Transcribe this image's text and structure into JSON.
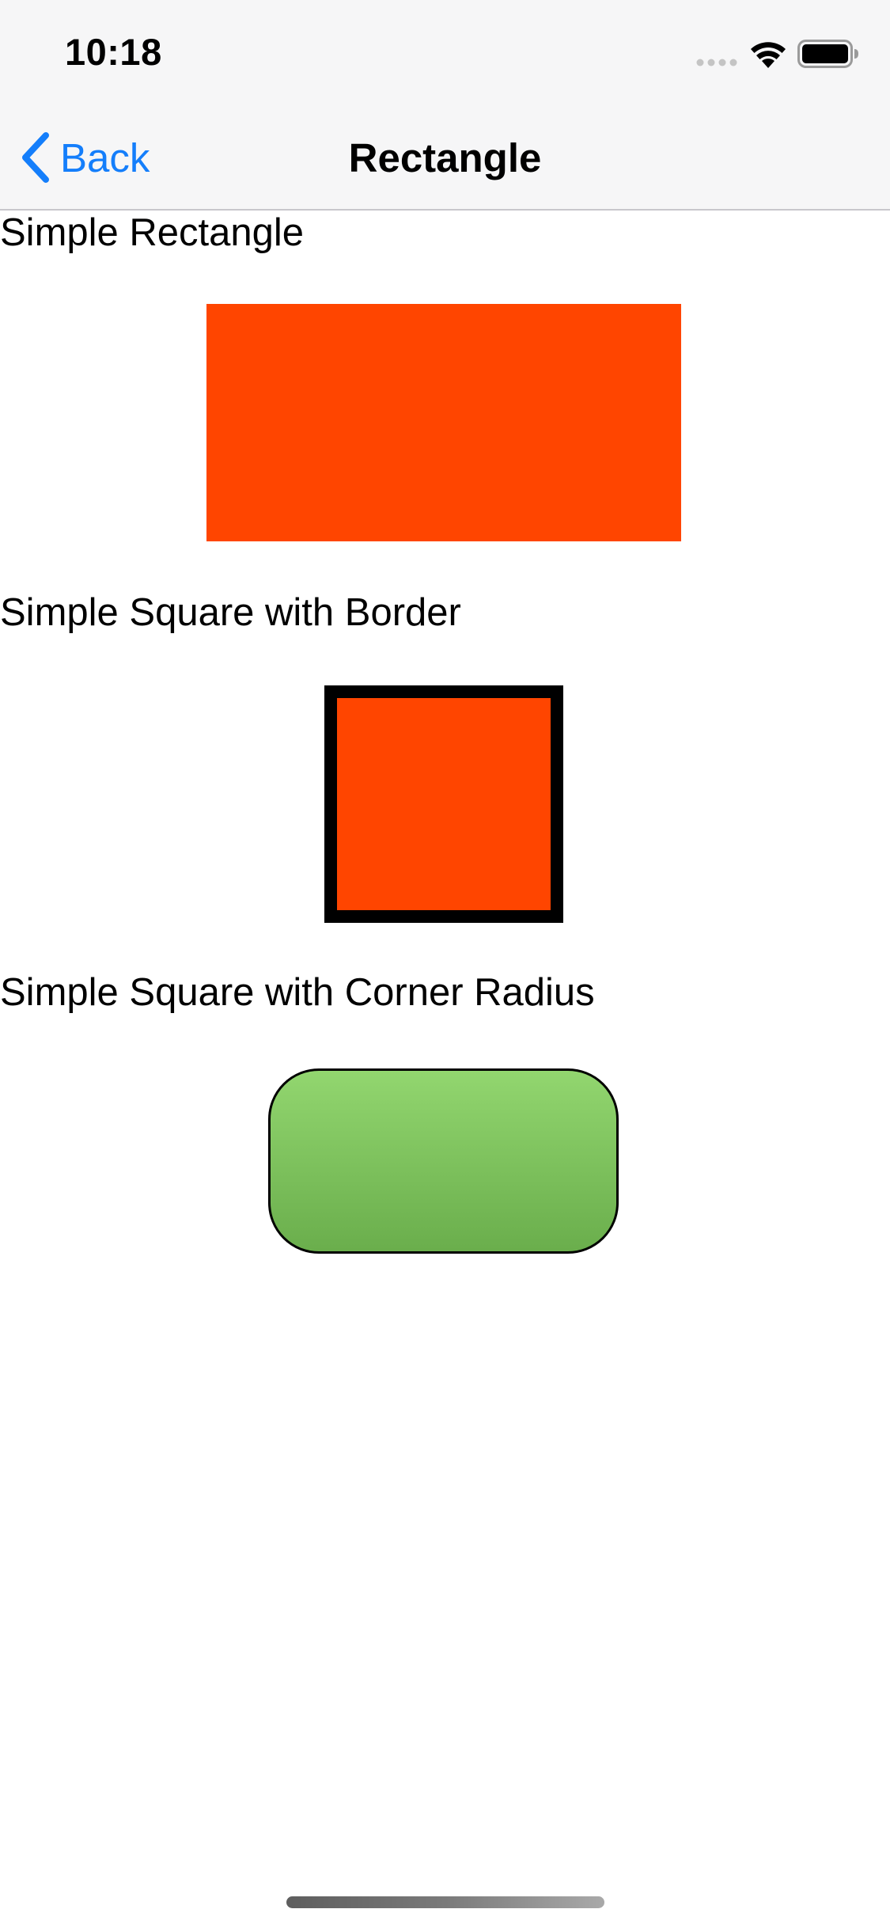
{
  "status_bar": {
    "time": "10:18",
    "icons": [
      "signal-dots-icon",
      "wifi-icon",
      "battery-icon"
    ]
  },
  "nav": {
    "back_label": "Back",
    "title": "Rectangle"
  },
  "sections": [
    {
      "label": "Simple Rectangle",
      "shape": "rectangle",
      "fill": "#ff4500"
    },
    {
      "label": "Simple Square with Border",
      "shape": "square",
      "fill": "#ff4500",
      "border_color": "#000000"
    },
    {
      "label": "Simple Square with Corner Radius",
      "shape": "rounded-rectangle",
      "fill_top": "#92d66f",
      "fill_bottom": "#6aae4c",
      "border_color": "#000000"
    }
  ],
  "colors": {
    "accent": "#147efb",
    "bar_background": "#f6f6f7"
  }
}
